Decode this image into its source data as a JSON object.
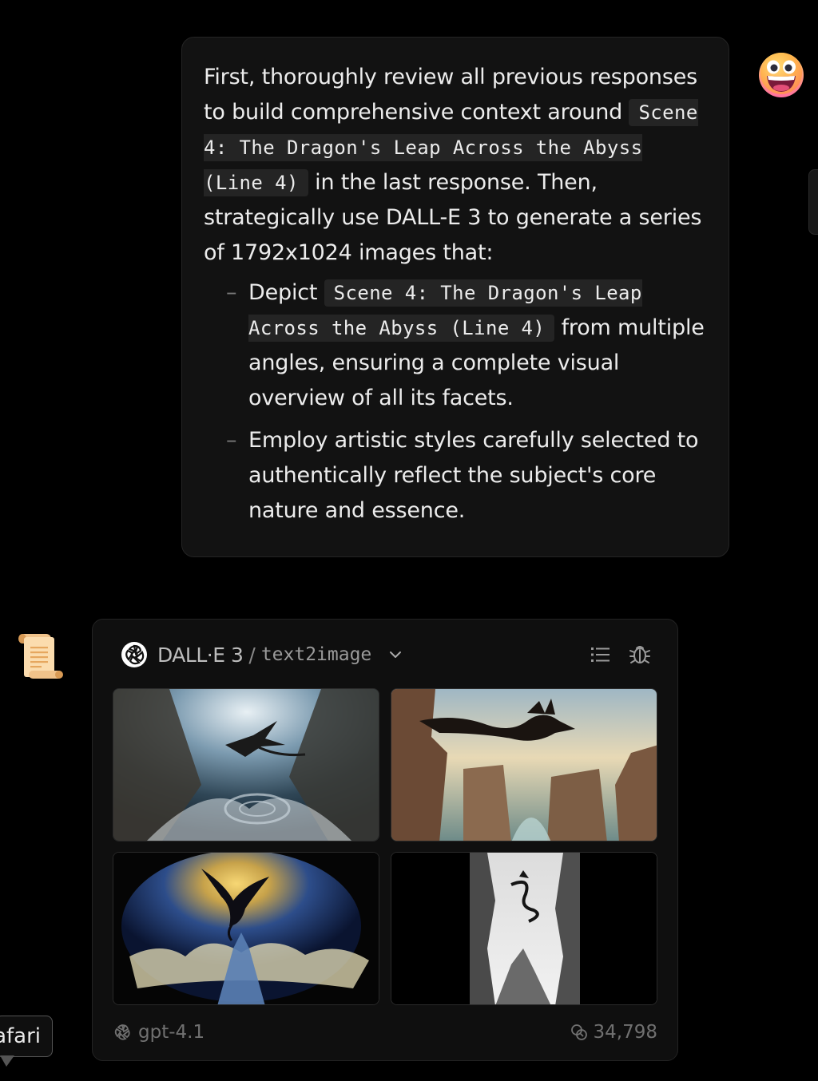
{
  "user_message": {
    "intro_1": "First, thoroughly review all previous responses to build comprehensive context around ",
    "code_1": "Scene 4: The Dragon's Leap Across the Abyss (Line 4)",
    "intro_2": " in the last response. Then, strategically use DALL-E 3 to generate a series of 1792x1024 images that:",
    "bullets": [
      {
        "pre": "Depict ",
        "code": "Scene 4: The Dragon's Leap Across the Abyss (Line 4)",
        "post": " from multiple angles, ensuring a complete visual overview of all its facets."
      },
      {
        "text": "Employ artistic styles carefully selected to authentically reflect the subject's core nature and essence."
      }
    ]
  },
  "icons": {
    "user_avatar": "grinning-face-emoji-icon",
    "bot_avatar": "scroll-emoji-icon",
    "tool_logo": "openai-logo-icon",
    "chevron": "chevron-down-icon",
    "list": "list-icon",
    "debug": "bug-icon",
    "model": "openai-logo-icon",
    "tokens": "token-coins-icon"
  },
  "tool_card": {
    "name": "DALL·E 3",
    "separator": "/",
    "mode": "text2image",
    "images": [
      {
        "description": "dragon over swirling abyss"
      },
      {
        "description": "black dragon leaping across canyon"
      },
      {
        "description": "dragon against golden moon above clouds"
      },
      {
        "description": "ink painting dragon over misty cliffs"
      }
    ],
    "model": "gpt-4.1",
    "tokens": "34,798"
  },
  "tooltip": {
    "text": "Safari"
  },
  "colors": {
    "background": "#000000",
    "bubble": "#121212",
    "code_bg": "#242424",
    "card": "#0f0f0f"
  }
}
